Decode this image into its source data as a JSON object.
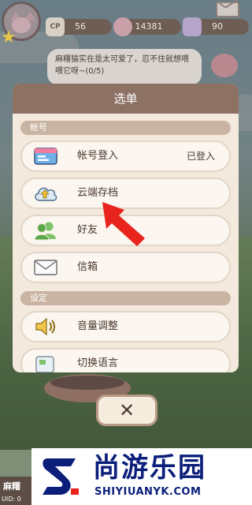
{
  "hud": {
    "cp_label": "CP",
    "cp_value": "56",
    "coins_value": "14381",
    "gems_value": "90"
  },
  "speech_text": "麻糬猫实在是太可爱了，忍不住就想喂喂它呀~(0/5)",
  "menu": {
    "title": "选单",
    "sections": [
      {
        "header": "帐号",
        "items": [
          {
            "label": "帐号登入",
            "status": "已登入",
            "icon": "account-card-icon"
          },
          {
            "label": "云端存档",
            "status": "",
            "icon": "cloud-upload-icon"
          },
          {
            "label": "好友",
            "status": "",
            "icon": "friends-icon"
          },
          {
            "label": "信箱",
            "status": "",
            "icon": "envelope-icon"
          }
        ]
      },
      {
        "header": "设定",
        "items": [
          {
            "label": "音量调整",
            "status": "",
            "icon": "speaker-icon"
          },
          {
            "label": "切换语言",
            "status": "",
            "icon": "language-icon"
          }
        ]
      }
    ],
    "close_label": "✕"
  },
  "watermark": {
    "title": "尚游乐园",
    "sub": "SHIYIUANYK.COM"
  },
  "corner_tag": {
    "name": "麻糬",
    "uid": "UID: 0"
  },
  "colors": {
    "modal_bg": "#f3e9dc",
    "header_brown": "#8d7264",
    "section_tan": "#c9b4a3",
    "arrow_red": "#e8241c",
    "watermark_blue": "#0a1e7a"
  }
}
